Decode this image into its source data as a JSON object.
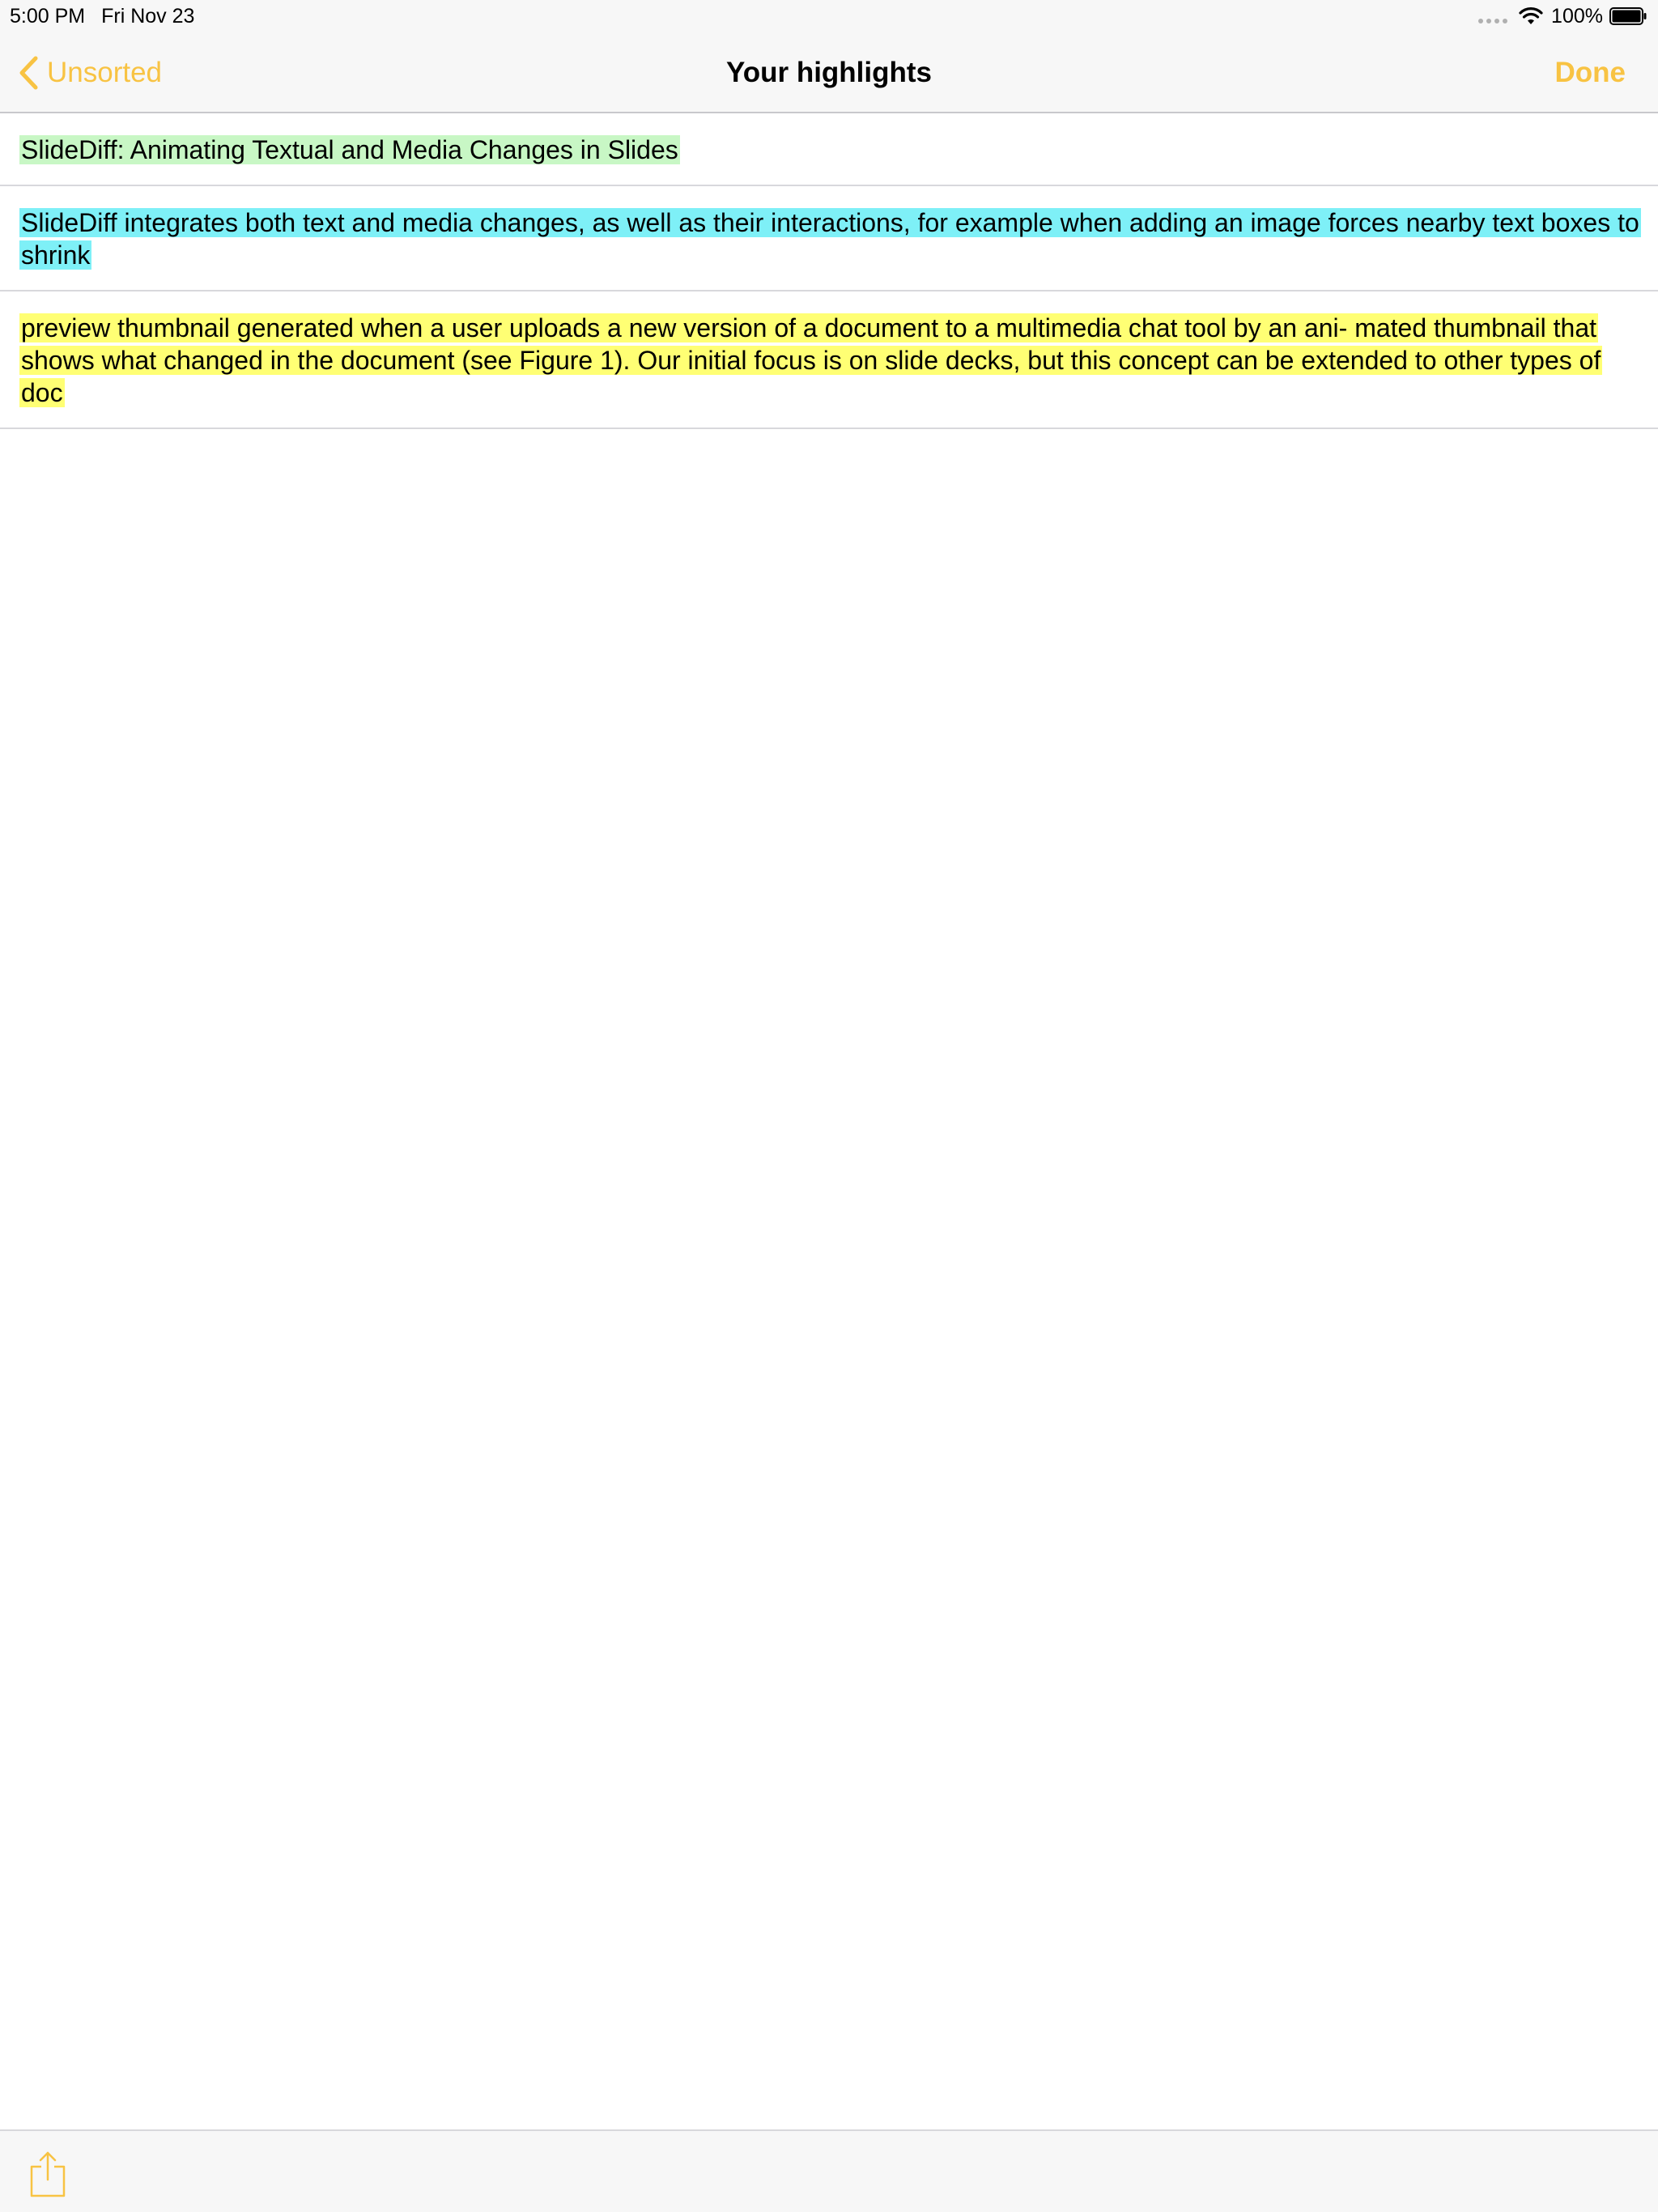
{
  "status_bar": {
    "time": "5:00 PM",
    "date": "Fri Nov 23",
    "battery": "100%"
  },
  "nav": {
    "back_label": "Unsorted",
    "title": "Your highlights",
    "done_label": "Done"
  },
  "highlights": [
    {
      "text": "SlideDiff: Animating Textual and Media Changes in Slides",
      "color": "#c8f7c5"
    },
    {
      "text": "SlideDiff integrates both text and media changes, as well as their interactions, for example when adding an image forces nearby text boxes to shrink",
      "color": "#7ef0f7"
    },
    {
      "text": "preview thumbnail generated when a user uploads a new version of a document to a multimedia chat tool by an ani- mated thumbnail that shows what changed in the document (see Figure 1). Our initial focus is on slide decks, but this concept can be extended to other types of doc",
      "color": "#ffff74"
    }
  ],
  "toolbar": {
    "share_icon": "share-icon"
  },
  "theme": {
    "accent": "#f8c343",
    "bar_background": "#f7f7f7",
    "separator": "#d8d8dc"
  }
}
